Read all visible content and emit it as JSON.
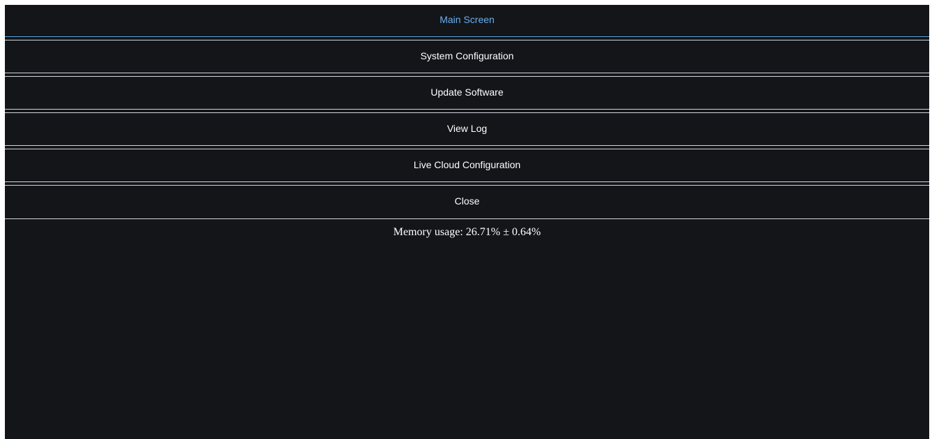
{
  "menu": {
    "items": [
      {
        "label": "Main Screen",
        "active": true
      },
      {
        "label": "System Configuration",
        "active": false
      },
      {
        "label": "Update Software",
        "active": false
      },
      {
        "label": "View Log",
        "active": false
      },
      {
        "label": "Live Cloud Configuration",
        "active": false
      },
      {
        "label": "Close",
        "active": false
      }
    ]
  },
  "status": {
    "memory_usage": "Memory usage: 26.71% ± 0.64%"
  },
  "colors": {
    "background": "#131519",
    "active_text": "#6aaef0",
    "text": "#ffffff",
    "divider": "#cfd6dc"
  }
}
